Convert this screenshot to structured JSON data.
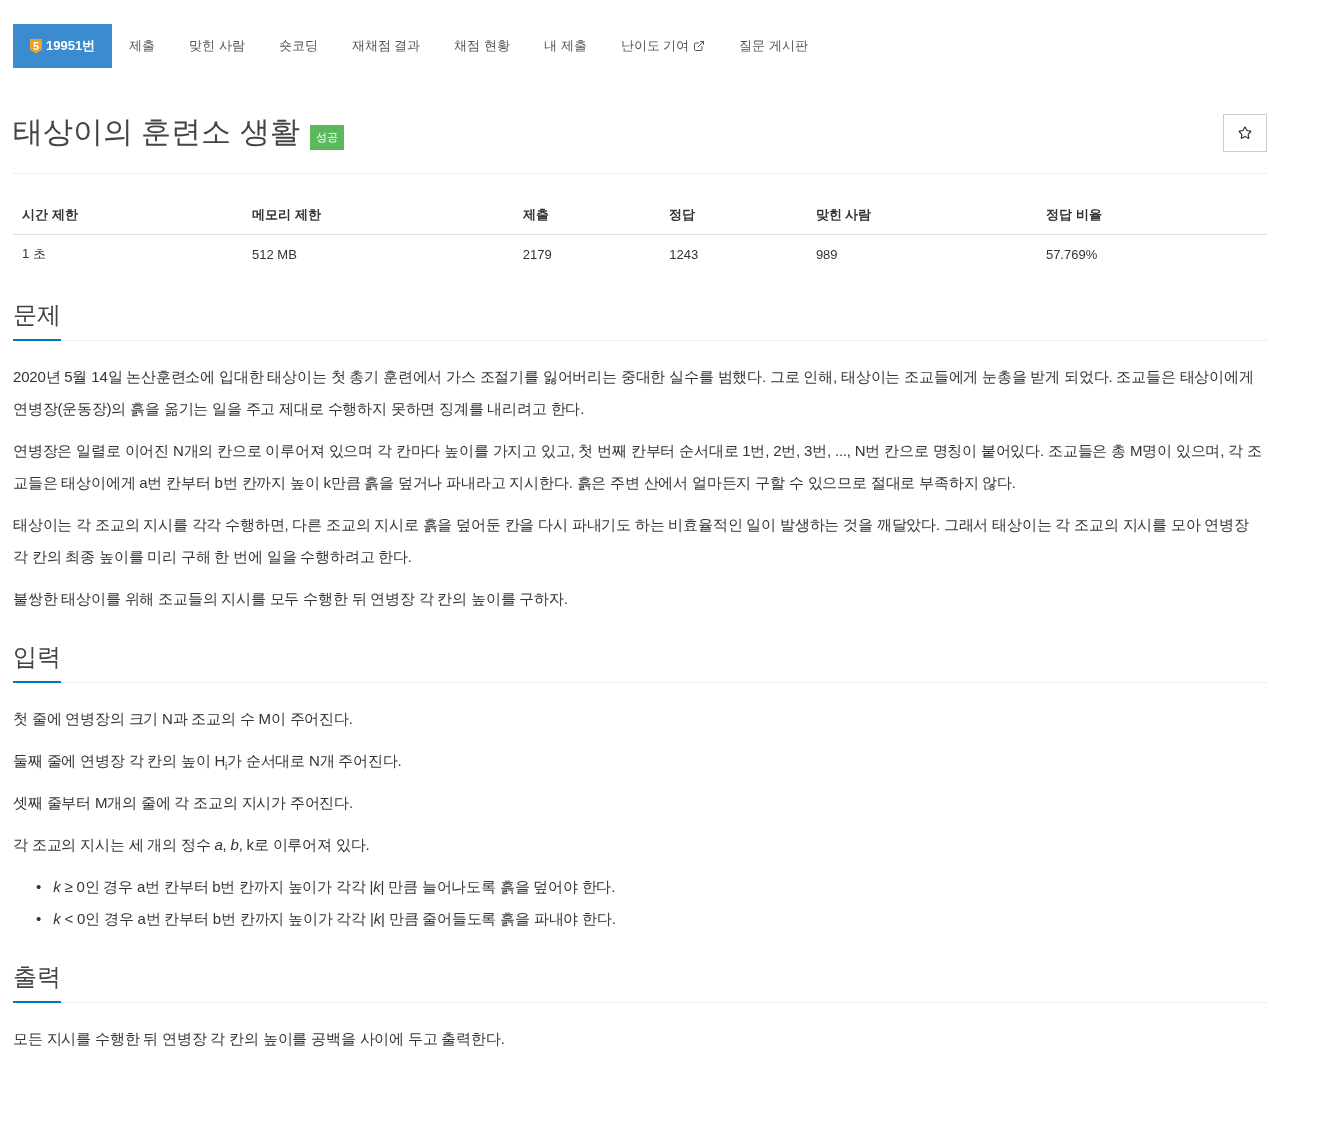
{
  "nav": {
    "tabs": [
      {
        "label": "19951번",
        "badge": "5",
        "selected": true,
        "external": false
      },
      {
        "label": "제출",
        "selected": false,
        "external": false
      },
      {
        "label": "맞힌 사람",
        "selected": false,
        "external": false
      },
      {
        "label": "숏코딩",
        "selected": false,
        "external": false
      },
      {
        "label": "재채점 결과",
        "selected": false,
        "external": false
      },
      {
        "label": "채점 현황",
        "selected": false,
        "external": false
      },
      {
        "label": "내 제출",
        "selected": false,
        "external": false
      },
      {
        "label": "난이도 기여",
        "selected": false,
        "external": true
      },
      {
        "label": "질문 게시판",
        "selected": false,
        "external": false
      }
    ]
  },
  "problem": {
    "title": "태상이의 훈련소 생활",
    "result_label": "성공"
  },
  "info_table": {
    "columns": [
      "시간 제한",
      "메모리 제한",
      "제출",
      "정답",
      "맞힌 사람",
      "정답 비율"
    ],
    "rows": [
      [
        "1 초",
        "512 MB",
        "2179",
        "1243",
        "989",
        "57.769%"
      ]
    ]
  },
  "sections": [
    {
      "heading": "문제",
      "paragraphs": [
        "2020년 5월 14일 논산훈련소에 입대한 태상이는 첫 총기 훈련에서 가스 조절기를 잃어버리는 중대한 실수를 범했다. 그로 인해, 태상이는 조교들에게 눈총을 받게 되었다. 조교들은 태상이에게 연병장(운동장)의 흙을 옮기는 일을 주고 제대로 수행하지 못하면 징계를 내리려고 한다.",
        "연병장은 일렬로 이어진 N개의 칸으로 이루어져 있으며 각 칸마다 높이를 가지고 있고, 첫 번째 칸부터 순서대로 1번, 2번, 3번, ..., N번 칸으로 명칭이 붙어있다. 조교들은 총 M명이 있으며, 각 조교들은 태상이에게 a번 칸부터 b번 칸까지 높이 k만큼 흙을 덮거나 파내라고 지시한다. 흙은 주변 산에서 얼마든지 구할 수 있으므로 절대로 부족하지 않다.",
        "태상이는 각 조교의 지시를 각각 수행하면, 다른 조교의 지시로 흙을 덮어둔 칸을 다시 파내기도 하는 비효율적인 일이 발생하는 것을 깨달았다. 그래서 태상이는 각 조교의 지시를 모아 연병장 각 칸의 최종 높이를 미리 구해 한 번에 일을 수행하려고 한다.",
        "불쌍한 태상이를 위해 조교들의 지시를 모두 수행한 뒤 연병장 각 칸의 높이를 구하자."
      ]
    },
    {
      "heading": "입력",
      "paragraphs": [
        "첫 줄에 연병장의 크기 N과 조교의 수 M이 주어진다.",
        "둘째 줄에 연병장 각 칸의 높이 H$_{i}$가 순서대로 N개 주어진다.",
        "셋째 줄부터 M개의 줄에 각 조교의 지시가 주어진다.",
        "각 조교의 지시는 세 개의 정수 *a*, *b*, k로 이루어져 있다."
      ],
      "bullets": [
        {
          "marker": "•",
          "text": "*k* ≥ 0인 경우 a번 칸부터 b번 칸까지 높이가 각각 |*k*| 만큼 늘어나도록 흙을 덮어야 한다."
        },
        {
          "marker": "•",
          "text": "*k* < 0인 경우 a번 칸부터 b번 칸까지 높이가 각각 |*k*| 만큼 줄어들도록 흙을 파내야 한다."
        }
      ]
    },
    {
      "heading": "출력",
      "paragraphs": [
        "모든 지시를 수행한 뒤 연병장 각 칸의 높이를 공백을 사이에 두고 출력한다."
      ]
    }
  ]
}
